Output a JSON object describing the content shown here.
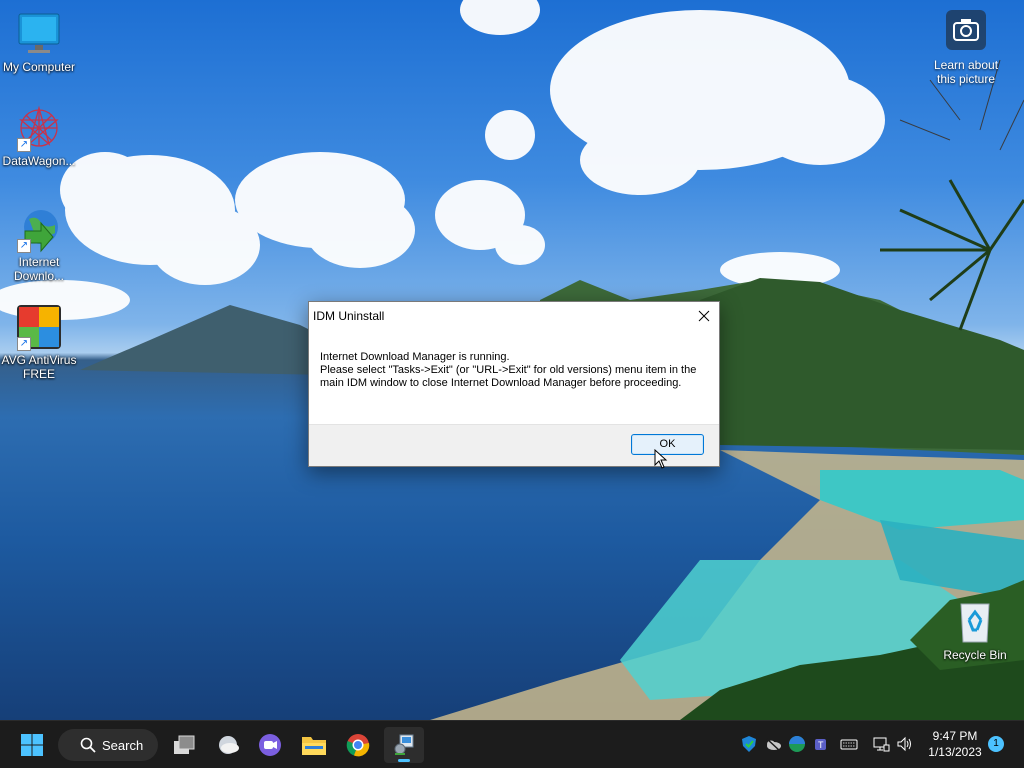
{
  "desktop": {
    "icons": [
      {
        "label": "My Computer"
      },
      {
        "label": "DataWagon..."
      },
      {
        "label": "Internet\nDownlo..."
      },
      {
        "label": "AVG AntiVirus\nFREE"
      },
      {
        "label": "Recycle Bin"
      }
    ],
    "learn_label": "Learn about\nthis picture"
  },
  "dialog": {
    "title": "IDM Uninstall",
    "line1": "Internet Download Manager is running.",
    "line2": "Please select \"Tasks->Exit\" (or \"URL->Exit\" for old versions) menu item in the main IDM window to close Internet Download Manager before proceeding.",
    "ok_label": "OK"
  },
  "taskbar": {
    "search_label": "Search",
    "clock_time": "9:47 PM",
    "clock_date": "1/13/2023",
    "notification_count": "1",
    "accent": "#4cc2ff"
  },
  "icons": [
    "start-icon",
    "search-icon",
    "task-view-icon",
    "widgets-icon",
    "chat-icon",
    "file-explorer-icon",
    "chrome-icon",
    "idm-setup-icon",
    "defender-icon",
    "onedrive-icon",
    "edge-icon",
    "teams-icon",
    "keyboard-icon",
    "network-icon",
    "volume-icon"
  ]
}
